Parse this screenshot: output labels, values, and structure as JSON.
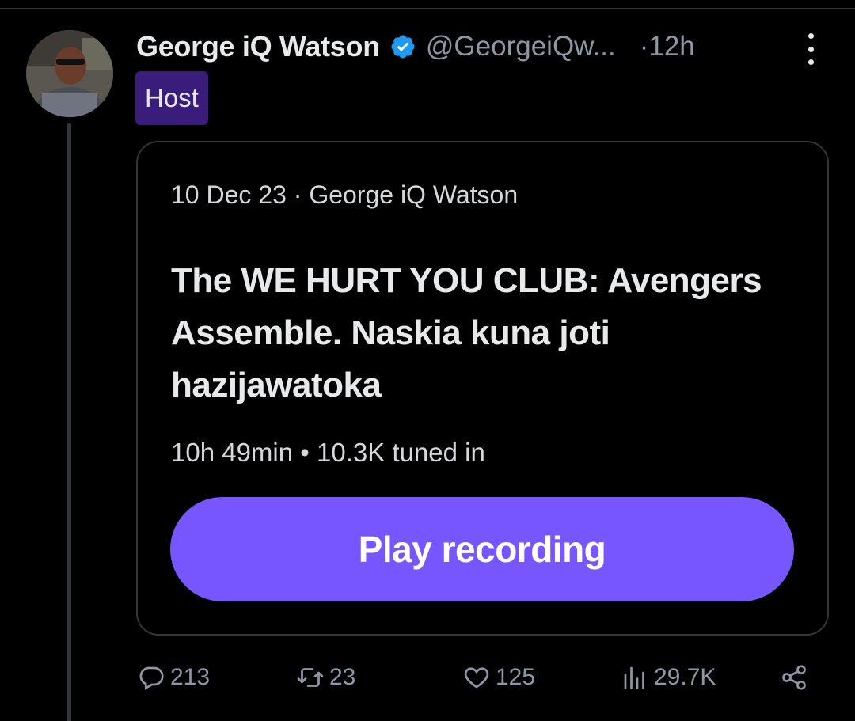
{
  "tweet": {
    "display_name": "George iQ Watson",
    "handle": "@GeorgeiQw...",
    "time": "·12h",
    "badge": "Host",
    "avatar": "avatar-photo",
    "verified_icon": "verified-badge-icon",
    "more_icon": "more-vertical-icon"
  },
  "space_card": {
    "meta": "10 Dec 23 · George iQ Watson",
    "title": "The WE HURT YOU CLUB: Avengers Assemble. Naskia kuna joti hazijawatoka",
    "stats": "10h 49min • 10.3K tuned in",
    "play_label": "Play recording"
  },
  "actions": {
    "replies": "213",
    "reposts": "23",
    "likes": "125",
    "views": "29.7K"
  },
  "colors": {
    "background": "#000000",
    "accent": "#7856ff",
    "verified": "#1d9bf0",
    "badge_bg": "#3a1d7a",
    "muted_text": "#8b98a5"
  }
}
